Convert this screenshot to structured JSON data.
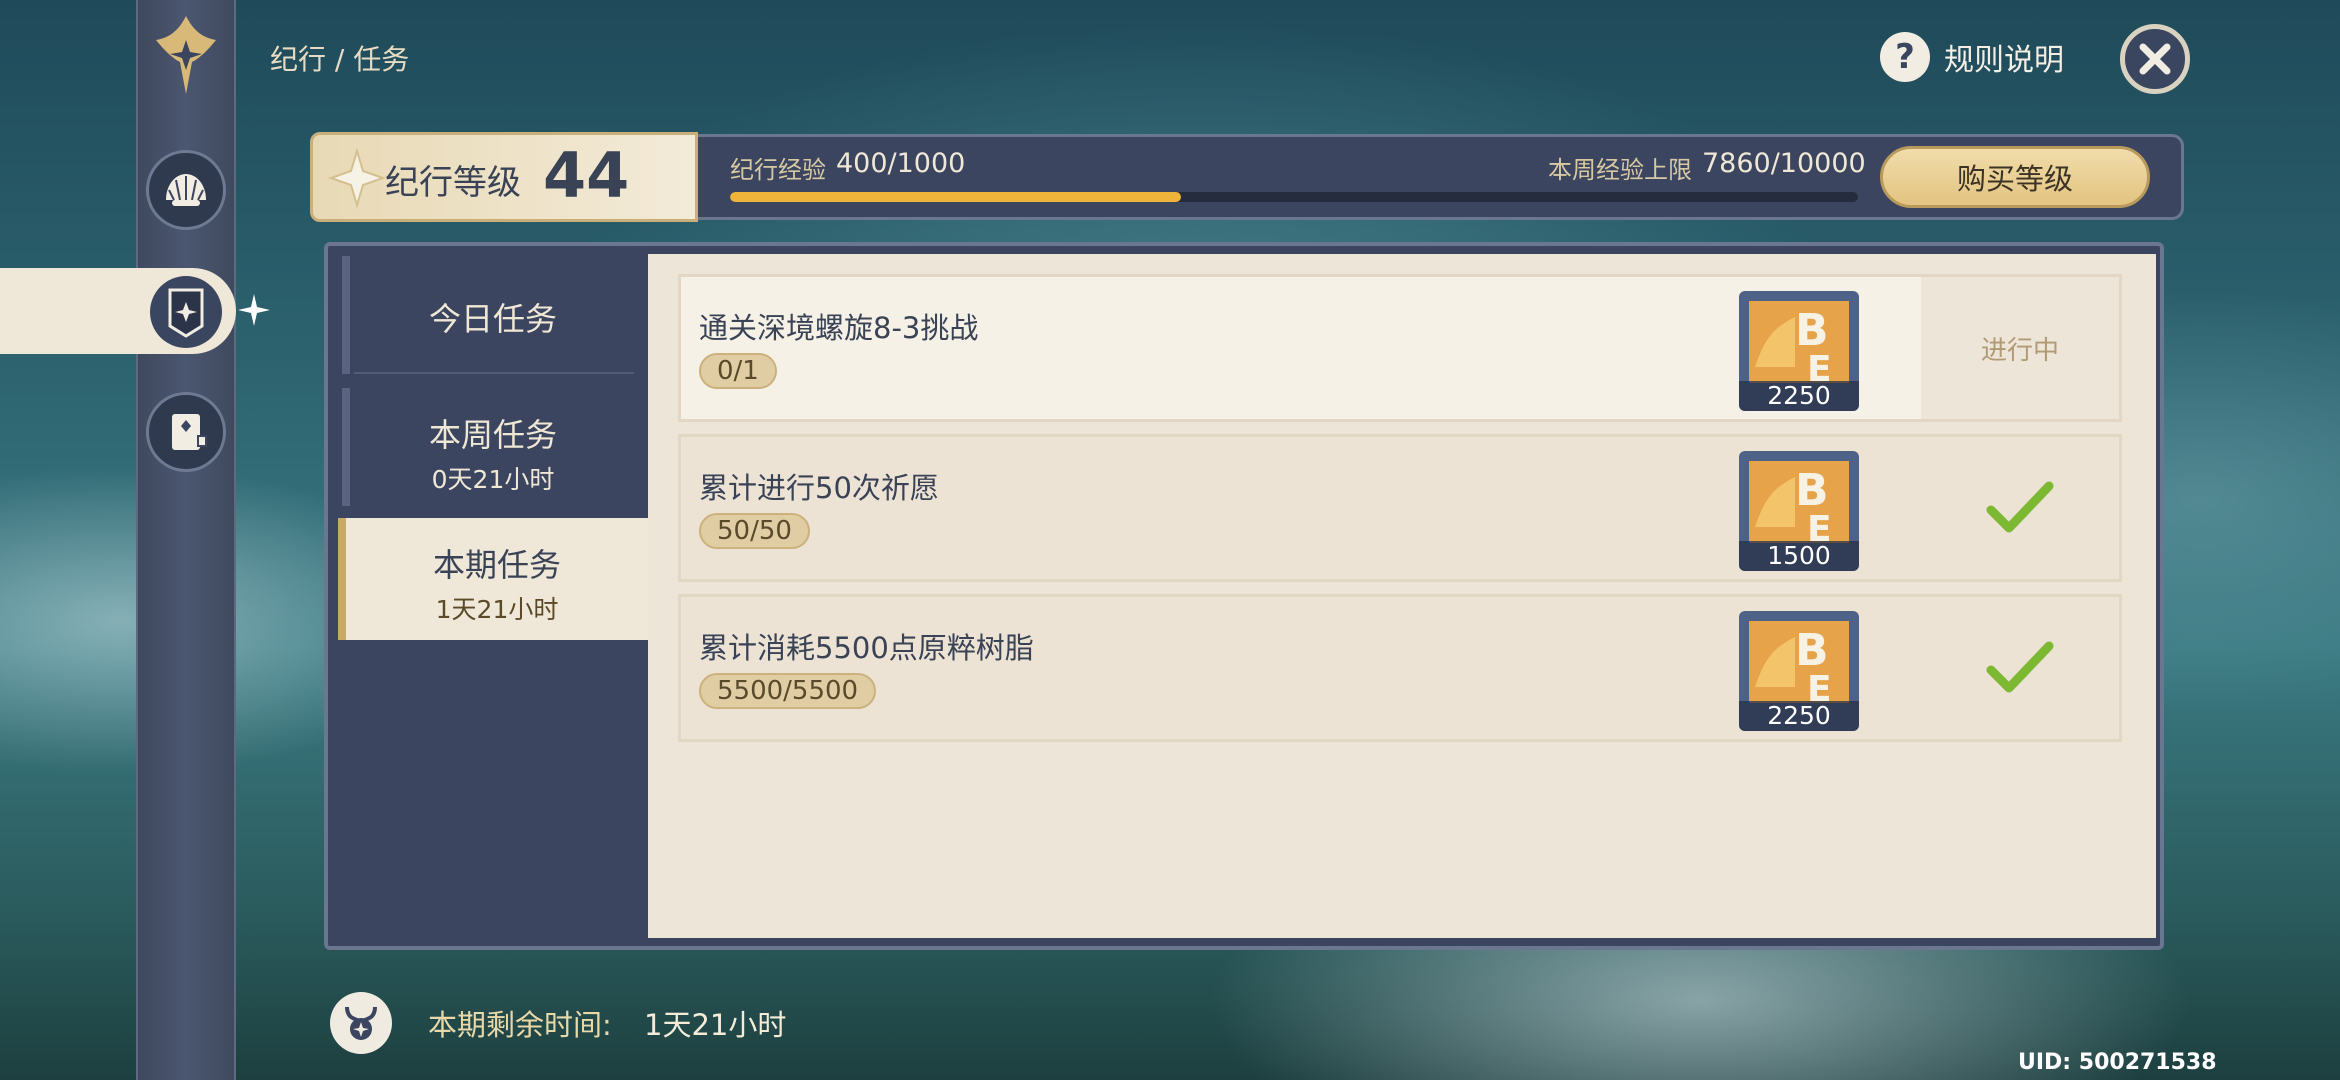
{
  "header": {
    "breadcrumb": "纪行 / 任务",
    "help_label": "规则说明",
    "help_icon": "question-icon",
    "close_icon": "close-icon"
  },
  "level": {
    "label": "纪行等级",
    "value": "44",
    "exp_label": "纪行经验",
    "exp_value": "400/1000",
    "exp_progress": 0.4,
    "weekly_cap_label": "本周经验上限",
    "weekly_cap_value": "7860/10000",
    "buy_label": "购买等级"
  },
  "tabs": [
    {
      "title": "今日任务",
      "subtitle": ""
    },
    {
      "title": "本周任务",
      "subtitle": "0天21小时"
    },
    {
      "title": "本期任务",
      "subtitle": "1天21小时"
    }
  ],
  "active_tab": 2,
  "tasks": [
    {
      "title": "通关深境螺旋8-3挑战",
      "count": "0/1",
      "reward_qty": "2250",
      "status": "进行中"
    },
    {
      "title": "累计进行50次祈愿",
      "count": "50/50",
      "reward_qty": "1500",
      "status": "complete"
    },
    {
      "title": "累计消耗5500点原粹树脂",
      "count": "5500/5500",
      "reward_qty": "2250",
      "status": "complete"
    }
  ],
  "footer": {
    "remaining_label": "本期剩余时间:",
    "remaining_value": "1天21小时"
  },
  "uid": "UID: 500271538",
  "colors": {
    "accent_gold": "#f0b43a",
    "panel_dark": "#3b4560",
    "card_light": "#ede5d7",
    "check_green": "#7cb832"
  }
}
